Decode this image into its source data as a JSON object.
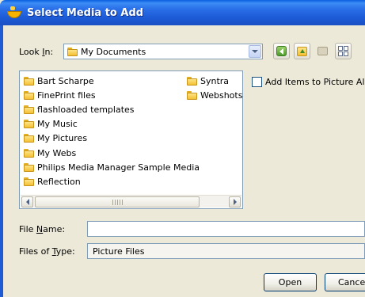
{
  "window": {
    "title": "Select Media to Add",
    "icon": "media-app-icon"
  },
  "look_in": {
    "label_prefix": "Look ",
    "label_accel": "I",
    "label_suffix": "n:",
    "value": "My Documents",
    "icon": "folder-icon"
  },
  "toolbar": {
    "buttons": [
      {
        "name": "back-button",
        "icon": "back-arrow-icon"
      },
      {
        "name": "up-one-level-button",
        "icon": "up-folder-icon"
      },
      {
        "name": "new-folder-button",
        "icon": "new-folder-icon"
      },
      {
        "name": "view-menu-button",
        "icon": "view-grid-icon"
      }
    ]
  },
  "file_list": {
    "column1": [
      "Bart Scharpe",
      "FinePrint files",
      "flashloaded templates",
      "My Music",
      "My Pictures",
      "My Webs",
      "Philips Media Manager Sample Media",
      "Reflection"
    ],
    "column2": [
      "Syntra",
      "Webshots"
    ]
  },
  "add_to_album": {
    "label": "Add Items to Picture Albu",
    "checked": false
  },
  "file_name": {
    "label_prefix": "File ",
    "label_accel": "N",
    "label_suffix": "ame:",
    "value": ""
  },
  "files_of_type": {
    "label_prefix": "Files of ",
    "label_accel": "T",
    "label_suffix": "ype:",
    "value": "Picture Files"
  },
  "buttons": {
    "open": "Open",
    "cancel": "Cancel"
  },
  "colors": {
    "titlebar": "#1d5bd6",
    "dialog_bg": "#ece9d8",
    "field_border": "#7f9db9"
  }
}
